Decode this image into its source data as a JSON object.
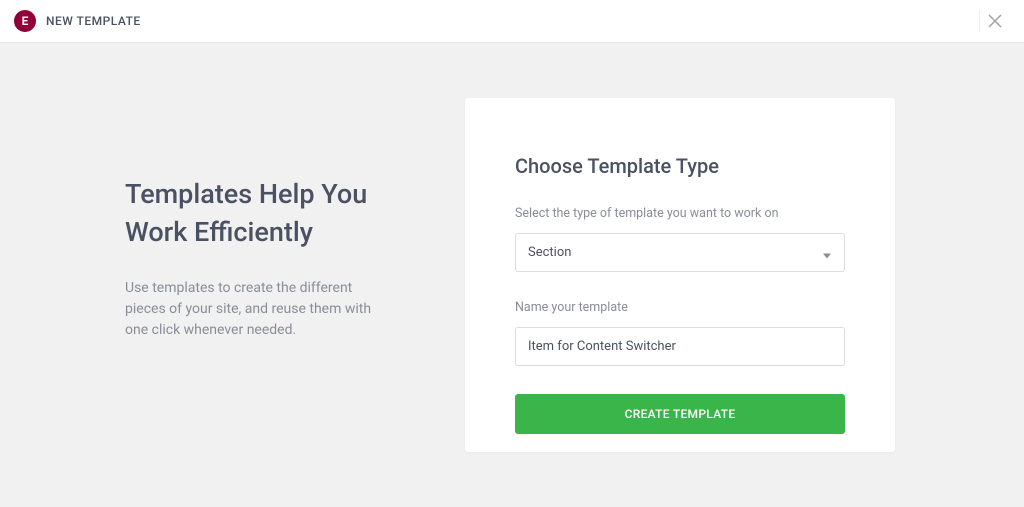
{
  "header": {
    "title": "NEW TEMPLATE"
  },
  "left": {
    "heading_line1": "Templates Help You",
    "heading_line2": "Work Efficiently",
    "description": "Use templates to create the different pieces of your site, and reuse them with one click whenever needed."
  },
  "card": {
    "heading": "Choose Template Type",
    "type_label": "Select the type of template you want to work on",
    "type_value": "Section",
    "name_label": "Name your template",
    "name_value": "Item for Content Switcher",
    "button_label": "CREATE TEMPLATE"
  }
}
